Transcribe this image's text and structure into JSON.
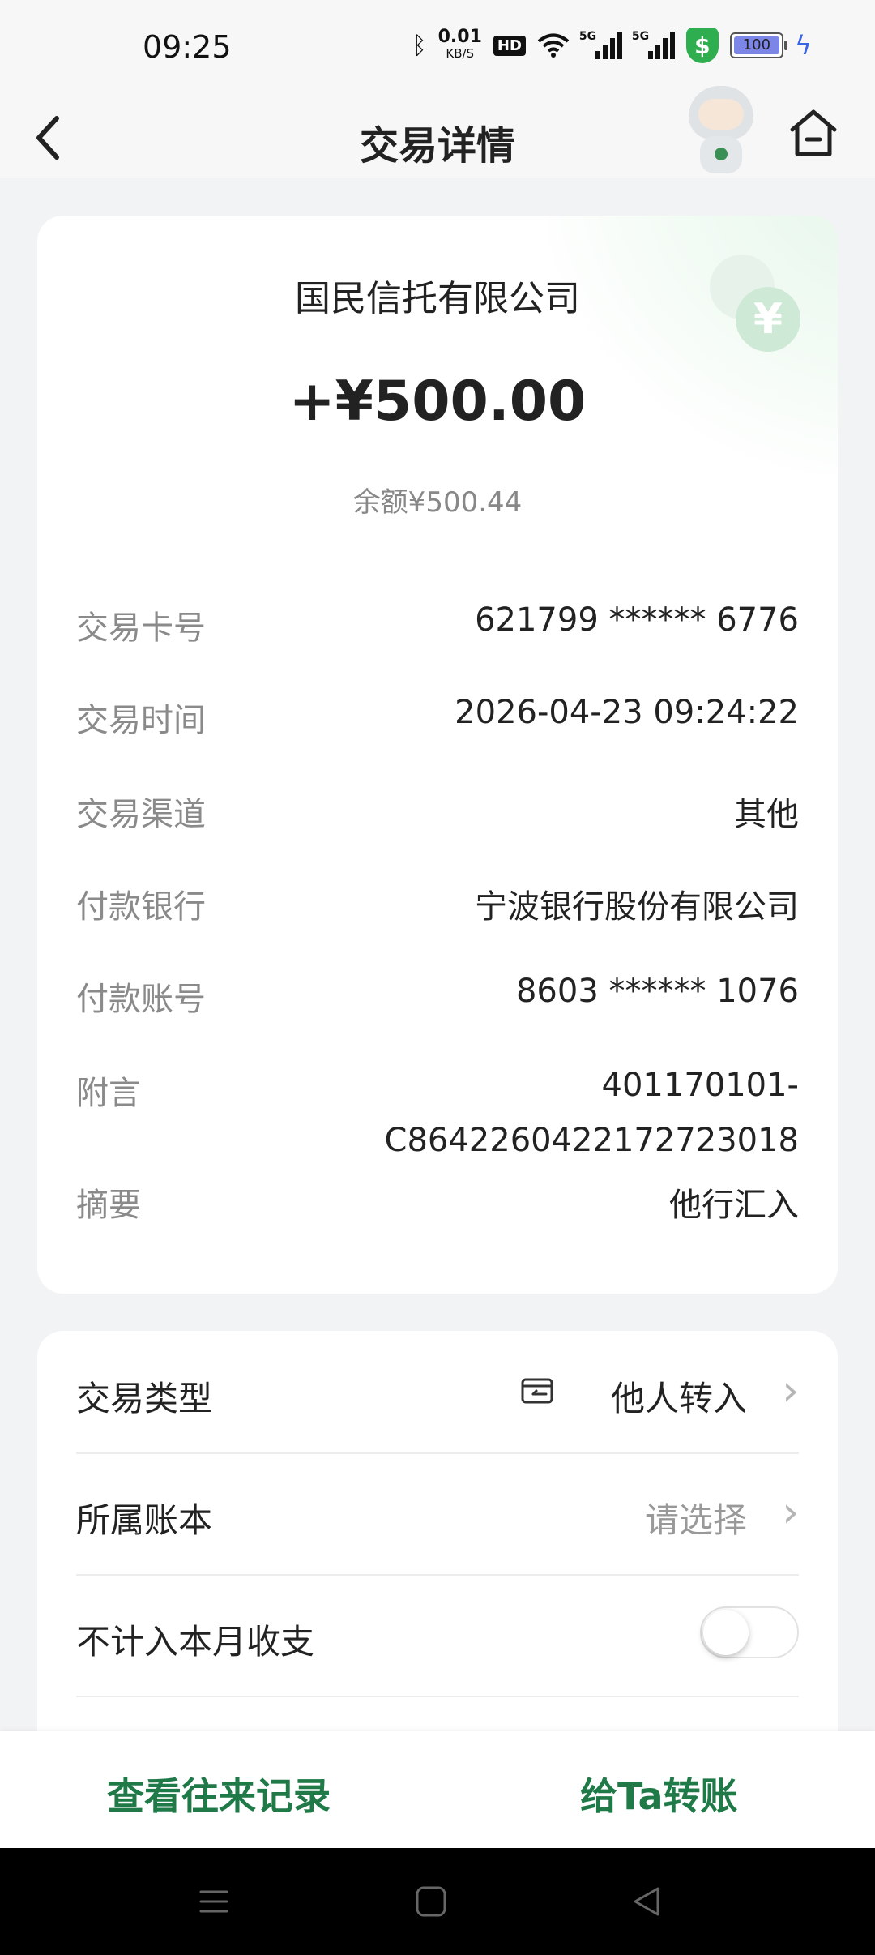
{
  "status_bar": {
    "time": "09:25",
    "net_speed_value": "0.01",
    "net_speed_unit": "KB/S",
    "hd_label": "HD",
    "signal1_label": "5G",
    "signal2_label": "5G",
    "shield_label": "$",
    "battery_level": "100"
  },
  "header": {
    "title": "交易详情"
  },
  "summary": {
    "payer_name": "国民信托有限公司",
    "amount": "+¥500.00",
    "balance": "余额¥500.44",
    "coin_symbol": "¥"
  },
  "details": [
    {
      "label": "交易卡号",
      "value": "621799 ****** 6776"
    },
    {
      "label": "交易时间",
      "value": "2026-04-23 09:24:22"
    },
    {
      "label": "交易渠道",
      "value": "其他"
    },
    {
      "label": "付款银行",
      "value": "宁波银行股份有限公司"
    },
    {
      "label": "付款账号",
      "value": "8603 ****** 1076"
    },
    {
      "label": "附言",
      "value_line1": "401170101-",
      "value_line2": "C864226042217272301 8"
    },
    {
      "label": "摘要",
      "value": "他行汇入"
    }
  ],
  "settings": {
    "type_label": "交易类型",
    "type_value": "他人转入",
    "book_label": "所属账本",
    "book_placeholder": "请选择",
    "exclude_label": "不计入本月收支",
    "exclude_on": false
  },
  "actions": {
    "history": "查看往来记录",
    "transfer": "给Ta转账"
  },
  "colors": {
    "accent": "#1f7a48",
    "background": "#f2f3f5"
  }
}
